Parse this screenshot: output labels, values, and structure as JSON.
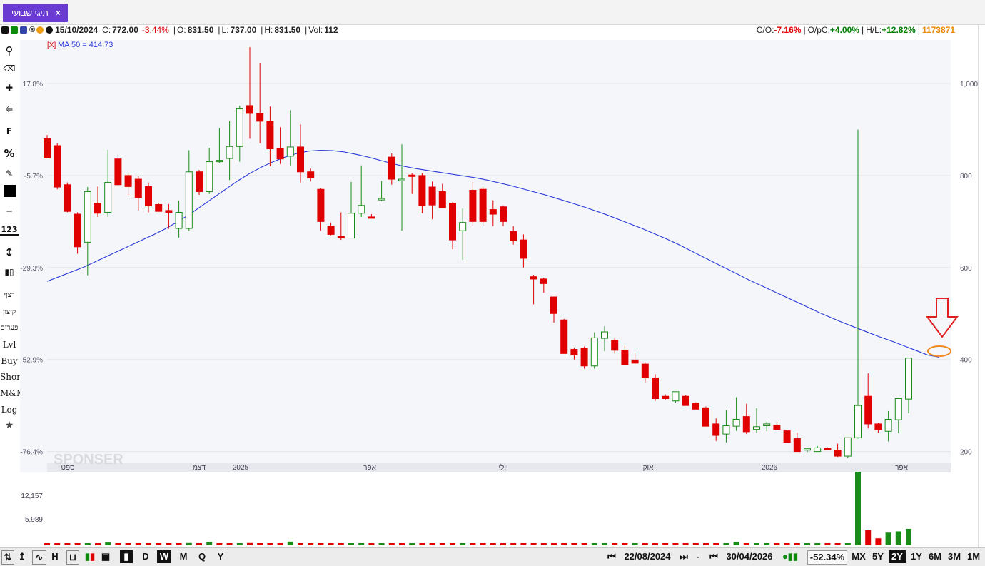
{
  "tab": {
    "title": "תיגי שבועי",
    "close": "×"
  },
  "info": {
    "date": "15/10/2024",
    "c_label": "C:",
    "c_val": "772.00",
    "c_chg": "-3.44%",
    "o_label": "O:",
    "o_val": "831.50",
    "l_label": "L:",
    "l_val": "737.00",
    "h_label": "H:",
    "h_val": "831.50",
    "vol_label": "Vol:",
    "vol_val": "112",
    "co_label": "C/O:",
    "co_val": "-7.16%",
    "opc_label": "O/pC:",
    "opc_val": "+4.00%",
    "hl_label": "H/L:",
    "hl_val": "+12.82%",
    "code": "1173871",
    "ma_label": "MA 50 = 414.73",
    "ma_x": "[X]"
  },
  "left_tools": {
    "icons": [
      "search-icon",
      "eraser-icon",
      "crosshair-icon",
      "line-icon",
      "fib-icon",
      "percent-icon",
      "edit-icon",
      "color-icon",
      "hline-icon",
      "counter-icon",
      "vline-icon",
      "candles-icon"
    ],
    "f_label": "F",
    "pct_label": "%",
    "num_label": "123",
    "labels": [
      "רצף",
      "קיצון",
      "פערים",
      "Lvl",
      "Buy",
      "Short",
      "M&M",
      "Log"
    ],
    "star": "★"
  },
  "bottom": {
    "periods": [
      "D",
      "W",
      "M",
      "Q",
      "Y"
    ],
    "selected_period": "W",
    "start_date": "22/08/2024",
    "dash": "-",
    "end_date": "30/04/2026",
    "change": "-52.34%",
    "ranges": [
      "MX",
      "5Y",
      "2Y",
      "1Y",
      "6M",
      "3M",
      "1M"
    ],
    "selected_range": "2Y",
    "nav_first": "⏮",
    "nav_last": "⏭"
  },
  "watermark": "SPONSER",
  "chart_data": {
    "type": "candlestick",
    "title": "",
    "ylabel_right": [
      "1,000",
      "800",
      "600",
      "400",
      "200"
    ],
    "ylabel_left": [
      "17.8%",
      "-5.7%",
      "-29.3%",
      "-52.9%",
      "-76.4%"
    ],
    "ylim": [
      180,
      1090
    ],
    "x_labels": [
      "ספט",
      "דצמ",
      "2025",
      "אפר",
      "יולי",
      "אוק",
      "2026",
      "אפר"
    ],
    "volume_labels": [
      "12,157",
      "5,989"
    ],
    "ma_period": 50,
    "ma_last": 414.73,
    "ma": [
      570,
      580,
      590,
      600,
      612,
      624,
      636,
      648,
      660,
      672,
      685,
      700,
      716,
      734,
      752,
      770,
      788,
      804,
      818,
      830,
      840,
      848,
      853,
      855,
      854,
      851,
      846,
      840,
      833,
      826,
      820,
      815,
      811,
      807,
      803,
      799,
      795,
      790,
      784,
      778,
      771,
      764,
      757,
      749,
      741,
      733,
      724,
      715,
      705,
      695,
      685,
      674,
      663,
      651,
      638,
      625,
      612,
      599,
      586,
      573,
      561,
      549,
      537,
      525,
      513,
      501,
      490,
      479,
      469,
      459,
      449,
      440,
      430,
      420,
      410,
      405
    ],
    "ohlc": [
      [
        880,
        888,
        840,
        838
      ],
      [
        865,
        870,
        770,
        775
      ],
      [
        780,
        785,
        720,
        722
      ],
      [
        716,
        720,
        630,
        645
      ],
      [
        655,
        775,
        583,
        765
      ],
      [
        740,
        776,
        710,
        718
      ],
      [
        720,
        856,
        710,
        785
      ],
      [
        836,
        846,
        780,
        780
      ],
      [
        800,
        805,
        758,
        776
      ],
      [
        792,
        798,
        724,
        752
      ],
      [
        776,
        785,
        720,
        734
      ],
      [
        737,
        740,
        724,
        722
      ],
      [
        724,
        738,
        684,
        720
      ],
      [
        685,
        745,
        665,
        720
      ],
      [
        685,
        855,
        680,
        808
      ],
      [
        808,
        812,
        758,
        765
      ],
      [
        765,
        860,
        760,
        830
      ],
      [
        830,
        903,
        827,
        833
      ],
      [
        837,
        918,
        790,
        863
      ],
      [
        863,
        952,
        830,
        945
      ],
      [
        952,
        1079,
        880,
        935
      ],
      [
        935,
        1045,
        870,
        918
      ],
      [
        918,
        950,
        820,
        858
      ],
      [
        858,
        905,
        825,
        836
      ],
      [
        842,
        942,
        822,
        862
      ],
      [
        862,
        911,
        785,
        808
      ],
      [
        808,
        815,
        787,
        795
      ],
      [
        770,
        772,
        680,
        700
      ],
      [
        690,
        698,
        670,
        672
      ],
      [
        668,
        720,
        660,
        664
      ],
      [
        664,
        786,
        664,
        718
      ],
      [
        718,
        822,
        710,
        735
      ],
      [
        710,
        716,
        708,
        708
      ],
      [
        750,
        788,
        745,
        750
      ],
      [
        840,
        848,
        780,
        792
      ],
      [
        790,
        868,
        680,
        792
      ],
      [
        801,
        805,
        760,
        798
      ],
      [
        800,
        805,
        718,
        735
      ],
      [
        775,
        787,
        705,
        736
      ],
      [
        765,
        782,
        735,
        730
      ],
      [
        740,
        742,
        640,
        660
      ],
      [
        680,
        728,
        617,
        698
      ],
      [
        768,
        785,
        690,
        700
      ],
      [
        770,
        776,
        690,
        700
      ],
      [
        726,
        746,
        690,
        716
      ],
      [
        732,
        735,
        690,
        700
      ],
      [
        678,
        690,
        650,
        658
      ],
      [
        660,
        672,
        600,
        620
      ],
      [
        580,
        584,
        520,
        575
      ],
      [
        575,
        578,
        545,
        565
      ],
      [
        536,
        530,
        480,
        500
      ],
      [
        486,
        488,
        413,
        413
      ],
      [
        422,
        426,
        400,
        410
      ],
      [
        424,
        428,
        380,
        386
      ],
      [
        386,
        459,
        380,
        447
      ],
      [
        446,
        472,
        418,
        460
      ],
      [
        442,
        446,
        413,
        420
      ],
      [
        420,
        430,
        389,
        388
      ],
      [
        399,
        415,
        392,
        392
      ],
      [
        390,
        394,
        350,
        360
      ],
      [
        360,
        368,
        310,
        315
      ],
      [
        320,
        324,
        313,
        315
      ],
      [
        310,
        325,
        305,
        330
      ],
      [
        320,
        322,
        300,
        300
      ],
      [
        305,
        307,
        292,
        292
      ],
      [
        295,
        298,
        255,
        255
      ],
      [
        260,
        272,
        223,
        235
      ],
      [
        238,
        290,
        220,
        256
      ],
      [
        255,
        318,
        245,
        270
      ],
      [
        276,
        304,
        238,
        243
      ],
      [
        248,
        294,
        240,
        254
      ],
      [
        256,
        265,
        244,
        260
      ],
      [
        257,
        265,
        250,
        248
      ],
      [
        245,
        248,
        220,
        220
      ],
      [
        228,
        241,
        200,
        200
      ],
      [
        204,
        208,
        199,
        206
      ],
      [
        200,
        212,
        201,
        208
      ],
      [
        207,
        209,
        203,
        205
      ],
      [
        203,
        217,
        188,
        190
      ],
      [
        190,
        228,
        186,
        230
      ],
      [
        230,
        900,
        228,
        300
      ],
      [
        320,
        370,
        250,
        260
      ],
      [
        260,
        263,
        241,
        248
      ],
      [
        244,
        288,
        222,
        270
      ],
      [
        269,
        316,
        240,
        315
      ],
      [
        314,
        386,
        283,
        403
      ]
    ],
    "volume": [
      [
        100,
        0
      ],
      [
        100,
        0
      ],
      [
        100,
        0
      ],
      [
        100,
        0
      ],
      [
        120,
        1
      ],
      [
        100,
        0
      ],
      [
        220,
        1
      ],
      [
        100,
        0
      ],
      [
        100,
        0
      ],
      [
        100,
        0
      ],
      [
        110,
        0
      ],
      [
        100,
        0
      ],
      [
        80,
        0
      ],
      [
        100,
        0
      ],
      [
        180,
        1
      ],
      [
        100,
        0
      ],
      [
        260,
        1
      ],
      [
        100,
        0
      ],
      [
        100,
        0
      ],
      [
        120,
        1
      ],
      [
        180,
        0
      ],
      [
        130,
        0
      ],
      [
        100,
        0
      ],
      [
        100,
        0
      ],
      [
        290,
        1
      ],
      [
        100,
        0
      ],
      [
        100,
        0
      ],
      [
        100,
        0
      ],
      [
        100,
        0
      ],
      [
        100,
        0
      ],
      [
        120,
        1
      ],
      [
        100,
        1
      ],
      [
        80,
        0
      ],
      [
        100,
        1
      ],
      [
        160,
        0
      ],
      [
        100,
        0
      ],
      [
        100,
        1
      ],
      [
        100,
        0
      ],
      [
        100,
        0
      ],
      [
        100,
        0
      ],
      [
        100,
        0
      ],
      [
        100,
        1
      ],
      [
        100,
        0
      ],
      [
        100,
        0
      ],
      [
        100,
        0
      ],
      [
        100,
        0
      ],
      [
        100,
        0
      ],
      [
        100,
        0
      ],
      [
        100,
        0
      ],
      [
        100,
        0
      ],
      [
        100,
        0
      ],
      [
        100,
        0
      ],
      [
        100,
        0
      ],
      [
        100,
        0
      ],
      [
        100,
        1
      ],
      [
        100,
        1
      ],
      [
        100,
        0
      ],
      [
        100,
        0
      ],
      [
        100,
        1
      ],
      [
        100,
        0
      ],
      [
        100,
        0
      ],
      [
        100,
        0
      ],
      [
        100,
        0
      ],
      [
        100,
        0
      ],
      [
        100,
        0
      ],
      [
        130,
        0
      ],
      [
        100,
        0
      ],
      [
        120,
        1
      ],
      [
        260,
        1
      ],
      [
        100,
        0
      ],
      [
        100,
        1
      ],
      [
        100,
        1
      ],
      [
        100,
        0
      ],
      [
        100,
        0
      ],
      [
        100,
        0
      ],
      [
        100,
        1
      ],
      [
        100,
        1
      ],
      [
        100,
        0
      ],
      [
        100,
        0
      ],
      [
        100,
        1
      ],
      [
        5800,
        1
      ],
      [
        1200,
        0
      ],
      [
        550,
        0
      ],
      [
        1000,
        1
      ],
      [
        1100,
        1
      ],
      [
        1300,
        1
      ]
    ],
    "annotations": [
      "red-arrow",
      "orange-ellipse"
    ]
  }
}
